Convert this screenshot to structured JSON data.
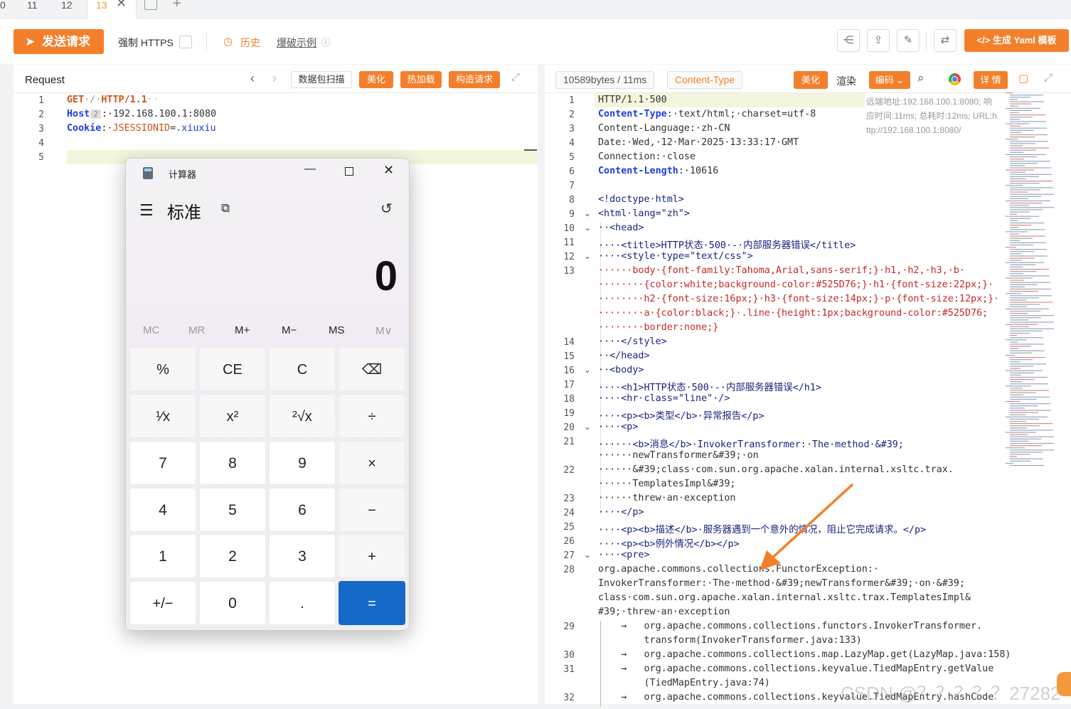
{
  "tabs": [
    {
      "label": "0"
    },
    {
      "label": "11"
    },
    {
      "label": "12"
    },
    {
      "label": "13",
      "active": true
    }
  ],
  "toolbar": {
    "send_label": "发送请求",
    "https_label": "强制 HTTPS",
    "history_label": "历史",
    "example_label": "爆破示例",
    "yaml_label": "生成 Yaml 模板"
  },
  "request": {
    "title": "Request",
    "scan_label": "数据包扫描",
    "beautify_label": "美化",
    "hotload_label": "热加载",
    "construct_label": "构造请求",
    "lines": [
      {
        "n": "1",
        "method": "GET",
        "sp1": "·/·",
        "proto": "HTTP/1.1",
        "tail": "··"
      },
      {
        "n": "2",
        "key": "Host",
        "badge": "2",
        "value": ":·192.168.100.1:8080"
      },
      {
        "n": "3",
        "key": "Cookie",
        "sep": ":·",
        "cname": "JSESSIONID",
        "eq": "=",
        "cval": ".xiuxiu"
      },
      {
        "n": "4"
      },
      {
        "n": "5"
      }
    ]
  },
  "response": {
    "size_label": "10589bytes / 11ms",
    "ctype_label": "Content-Type",
    "beautify_label": "美化",
    "render_label": "渲染",
    "encode_label": "编码",
    "detail_label": "详 情",
    "info_line1": "远端地址:192.168.100.1:8080; 响",
    "info_line2": "应时间:11ms; 总耗时:12ms; URL:h",
    "info_line3": "ttp://192.168.100.1:8080/",
    "lines": [
      {
        "n": "1",
        "t": "HTTP/1.1·500"
      },
      {
        "n": "2",
        "k": "Content-Type",
        "t": ":·text/html;·charset=utf-8"
      },
      {
        "n": "3",
        "t": "Content-Language:·zh-CN"
      },
      {
        "n": "4",
        "t": "Date:·Wed,·12·Mar·2025·13:33:17·GMT"
      },
      {
        "n": "5",
        "t": "Connection:·close"
      },
      {
        "n": "6",
        "k": "Content-Length",
        "t": ":·10616"
      },
      {
        "n": "7",
        "t": ""
      },
      {
        "n": "8",
        "t": "<!doctype·html>"
      },
      {
        "n": "9",
        "t": "<html·lang=\"zh\">"
      },
      {
        "n": "10",
        "t": "··<head>"
      },
      {
        "n": "11",
        "t": "····<title>HTTP状态·500·-·内部服务器错误</title>"
      },
      {
        "n": "12",
        "t": "····<style·type=\"text/css\">"
      },
      {
        "n": "13",
        "t": "······body·{font-family:Tahoma,Arial,sans-serif;}·h1,·h2,·h3,·b·"
      },
      {
        "n": "",
        "t": "········{color:white;background-color:#525D76;}·h1·{font-size:22px;}·"
      },
      {
        "n": "",
        "t": "········h2·{font-size:16px;}·h3·{font-size:14px;}·p·{font-size:12px;}·"
      },
      {
        "n": "",
        "t": "········a·{color:black;}·.line·{height:1px;background-color:#525D76;"
      },
      {
        "n": "",
        "t": "········border:none;}"
      },
      {
        "n": "14",
        "t": "····</style>"
      },
      {
        "n": "15",
        "t": "··</head>"
      },
      {
        "n": "16",
        "t": "··<body>"
      },
      {
        "n": "17",
        "t": "····<h1>HTTP状态·500·-·内部服务器错误</h1>"
      },
      {
        "n": "18",
        "t": "····<hr·class=\"line\"·/>"
      },
      {
        "n": "19",
        "t": "····<p><b>类型</b>·异常报告</p>"
      },
      {
        "n": "20",
        "t": "····<p>"
      },
      {
        "n": "21",
        "t": "······<b>消息</b>·InvokerTransformer:·The·method·&#39;"
      },
      {
        "n": "",
        "t": "······newTransformer&#39;·on"
      },
      {
        "n": "22",
        "t": "······&#39;class·com.sun.org.apache.xalan.internal.xsltc.trax."
      },
      {
        "n": "",
        "t": "······TemplatesImpl&#39;"
      },
      {
        "n": "23",
        "t": "······threw·an·exception"
      },
      {
        "n": "24",
        "t": "····</p>"
      },
      {
        "n": "25",
        "t": "····<p><b>描述</b>·服务器遇到一个意外的情况，阻止它完成请求。</p>"
      },
      {
        "n": "26",
        "t": "····<p><b>例外情况</b></p>"
      },
      {
        "n": "27",
        "t": "····<pre>"
      },
      {
        "n": "28",
        "t": "org.apache.commons.collections.FunctorException:·"
      },
      {
        "n": "",
        "t": "InvokerTransformer:·The·method·&#39;newTransformer&#39;·on·&#39;"
      },
      {
        "n": "",
        "t": "class·com.sun.org.apache.xalan.internal.xsltc.trax.TemplatesImpl&"
      },
      {
        "n": "",
        "t": "#39;·threw·an·exception"
      },
      {
        "n": "29",
        "t": "    →   org.apache.commons.collections.functors.InvokerTransformer."
      },
      {
        "n": "",
        "t": "        transform(InvokerTransformer.java:133)"
      },
      {
        "n": "30",
        "t": "    →   org.apache.commons.collections.map.LazyMap.get(LazyMap.java:158)"
      },
      {
        "n": "31",
        "t": "    →   org.apache.commons.collections.keyvalue.TiedMapEntry.getValue"
      },
      {
        "n": "",
        "t": "        (TiedMapEntry.java:74)"
      },
      {
        "n": "32",
        "t": "    →   org.apache.commons.collections.keyvalue.TiedMapEntry.hashCode"
      }
    ],
    "watermark": "CSDN @？？？？？27282"
  },
  "calculator": {
    "app_title": "计算器",
    "mode": "标准",
    "display": "0",
    "memory": [
      "MC",
      "MR",
      "M+",
      "M−",
      "MS",
      "M∨"
    ],
    "keys": [
      "%",
      "CE",
      "C",
      "⌫",
      "¹⁄x",
      "x²",
      "²√x",
      "÷",
      "7",
      "8",
      "9",
      "×",
      "4",
      "5",
      "6",
      "−",
      "1",
      "2",
      "3",
      "+",
      "+/−",
      "0",
      ".",
      "="
    ]
  },
  "colors": {
    "accent": "#f47f2b",
    "calc_equals": "#1469c7"
  }
}
